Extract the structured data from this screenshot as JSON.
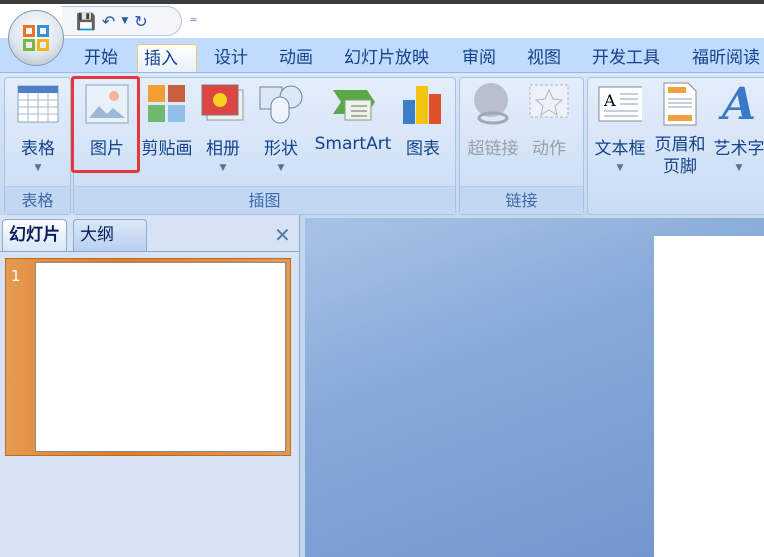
{
  "quick_access": {
    "save_icon": "save-icon",
    "undo_icon": "undo-icon",
    "redo_icon": "redo-icon",
    "customize_icon": "customize-icon"
  },
  "tabs": [
    "开始",
    "插入",
    "设计",
    "动画",
    "幻灯片放映",
    "审阅",
    "视图",
    "开发工具",
    "福昕阅读"
  ],
  "selected_tab": "插入",
  "groups": {
    "tables": {
      "label": "表格",
      "buttons": [
        {
          "label": "表格"
        }
      ]
    },
    "illustrations": {
      "label": "插图",
      "buttons": [
        {
          "label": "图片"
        },
        {
          "label": "剪贴画"
        },
        {
          "label": "相册"
        },
        {
          "label": "形状"
        },
        {
          "label": "SmartArt"
        },
        {
          "label": "图表"
        }
      ]
    },
    "links": {
      "label": "链接",
      "buttons": [
        {
          "label": "超链接"
        },
        {
          "label": "动作"
        }
      ]
    },
    "text": {
      "buttons": [
        {
          "label": "文本框"
        },
        {
          "label": "页眉和页脚"
        },
        {
          "label": "艺术字"
        }
      ]
    }
  },
  "panel": {
    "tabs": [
      "幻灯片",
      "大纲"
    ],
    "close": "✕",
    "slide_number": "1"
  },
  "colors": {
    "accent": "#e3383d",
    "ribbon": "#bfdbff",
    "thumb_selected": "#e07b25"
  }
}
